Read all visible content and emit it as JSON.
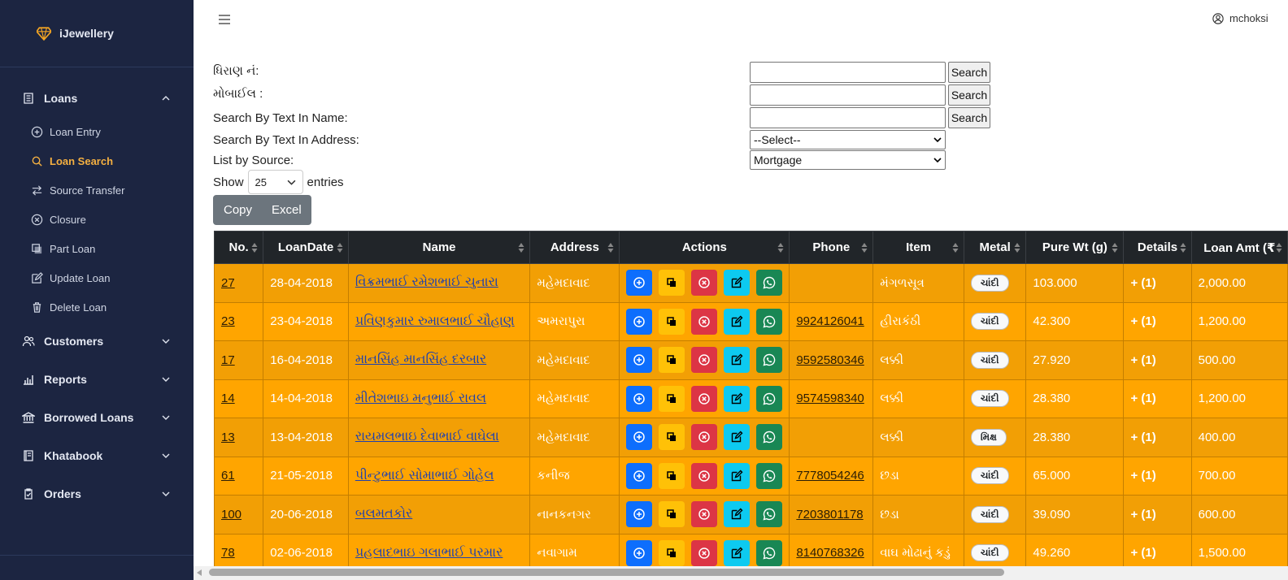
{
  "brand": {
    "name": "iJewellery",
    "icon": "diamond-icon",
    "color": "#f5a623"
  },
  "sidebar": {
    "groups": [
      {
        "label": "Loans",
        "icon": "list-icon",
        "expanded": true,
        "items": [
          {
            "label": "Loan Entry",
            "icon": "plus-circle-icon",
            "active": false
          },
          {
            "label": "Loan Search",
            "icon": "search-icon",
            "active": true
          },
          {
            "label": "Source Transfer",
            "icon": "transfer-icon",
            "active": false
          },
          {
            "label": "Closure",
            "icon": "close-circle-icon",
            "active": false
          },
          {
            "label": "Part Loan",
            "icon": "copy-icon",
            "active": false
          },
          {
            "label": "Update Loan",
            "icon": "edit-icon",
            "active": false
          },
          {
            "label": "Delete Loan",
            "icon": "trash-icon",
            "active": false
          }
        ]
      },
      {
        "label": "Customers",
        "icon": "users-icon",
        "expanded": false
      },
      {
        "label": "Reports",
        "icon": "bar-chart-icon",
        "expanded": false
      },
      {
        "label": "Borrowed Loans",
        "icon": "bank-icon",
        "expanded": false
      },
      {
        "label": "Khatabook",
        "icon": "book-icon",
        "expanded": false
      },
      {
        "label": "Orders",
        "icon": "clipboard-icon",
        "expanded": false
      }
    ]
  },
  "header": {
    "user": "mchoksi"
  },
  "search_form": {
    "dhiran_label": "ધિરાણ નં:",
    "mobile_label": "મોબાઈલ :",
    "name_label": "Search By Text In Name:",
    "address_label": "Search By Text In Address:",
    "source_label": "List by Source:",
    "search_button": "Search",
    "address_select": "--Select--",
    "source_select": "Mortgage",
    "show_label": "Show",
    "entries_label": "entries",
    "page_length": "25"
  },
  "export_buttons": {
    "copy": "Copy",
    "excel": "Excel"
  },
  "table": {
    "columns": [
      "No.",
      "LoanDate",
      "Name",
      "Address",
      "Actions",
      "Phone",
      "Item",
      "Metal",
      "Pure Wt (g)",
      "Details",
      "Loan Amt (₹"
    ],
    "rows": [
      {
        "no": "27",
        "date": "28-04-2018",
        "name": "વિક્રમભાઈ રમેશભાઈ ચુનારા",
        "address": "મહેમદાવાદ",
        "phone": "",
        "item": "મંગળસૂત્ર",
        "metal": "ચાંદી",
        "wt": "103.000",
        "details": "+ (1)",
        "amt": "2,000.00"
      },
      {
        "no": "23",
        "date": "23-04-2018",
        "name": "પ્રવિણકુમાર રુમાલભાઈ ચૌહાણ",
        "address": "અમરાપુરા",
        "phone": "9924126041",
        "item": "હીરાકંઠી",
        "metal": "ચાંદી",
        "wt": "42.300",
        "details": "+ (1)",
        "amt": "1,200.00"
      },
      {
        "no": "17",
        "date": "16-04-2018",
        "name": "માનસિંહ માનસિંહ દરબાર",
        "address": "મહેમદાવાદ",
        "phone": "9592580346",
        "item": "લક્કી",
        "metal": "ચાંદી",
        "wt": "27.920",
        "details": "+ (1)",
        "amt": "500.00"
      },
      {
        "no": "14",
        "date": "14-04-2018",
        "name": "મીતેશભાઇ મનુભાઈ રાવલ",
        "address": "મહેમદાવાદ",
        "phone": "9574598340",
        "item": "લક્કી",
        "metal": "ચાંદી",
        "wt": "28.380",
        "details": "+ (1)",
        "amt": "1,200.00"
      },
      {
        "no": "13",
        "date": "13-04-2018",
        "name": "રાયમલભાઇ દેવાભાઈ વાઘેલા",
        "address": "મહેમદાવાદ",
        "phone": "",
        "item": "લક્કી",
        "metal": "મિક્ષ",
        "wt": "28.380",
        "details": "+ (1)",
        "amt": "400.00"
      },
      {
        "no": "61",
        "date": "21-05-2018",
        "name": "પીન્ટુભાઈ સોમાભાઈ ગોહેલ",
        "address": "કનીજ",
        "phone": "7778054246",
        "item": "છડા",
        "metal": "ચાંદી",
        "wt": "65.000",
        "details": "+ (1)",
        "amt": "700.00"
      },
      {
        "no": "100",
        "date": "20-06-2018",
        "name": "બલમતકોર",
        "address": "નાનકનગર",
        "phone": "7203801178",
        "item": "છડા",
        "metal": "ચાંદી",
        "wt": "39.090",
        "details": "+ (1)",
        "amt": "600.00"
      },
      {
        "no": "78",
        "date": "02-06-2018",
        "name": "પ્રહલાદભાઇ ગલાભાઈ પરમાર",
        "address": "નવાગામ",
        "phone": "8140768326",
        "item": "વાઘ મોઢાનું કડું",
        "metal": "ચાંદી",
        "wt": "49.260",
        "details": "+ (1)",
        "amt": "1,500.00"
      }
    ]
  },
  "colors": {
    "sidebar_bg": "#1c2541",
    "row_even": "#f29f05",
    "row_odd": "#ffa500",
    "header_bg": "#212529",
    "active_nav": "#f5b041"
  }
}
